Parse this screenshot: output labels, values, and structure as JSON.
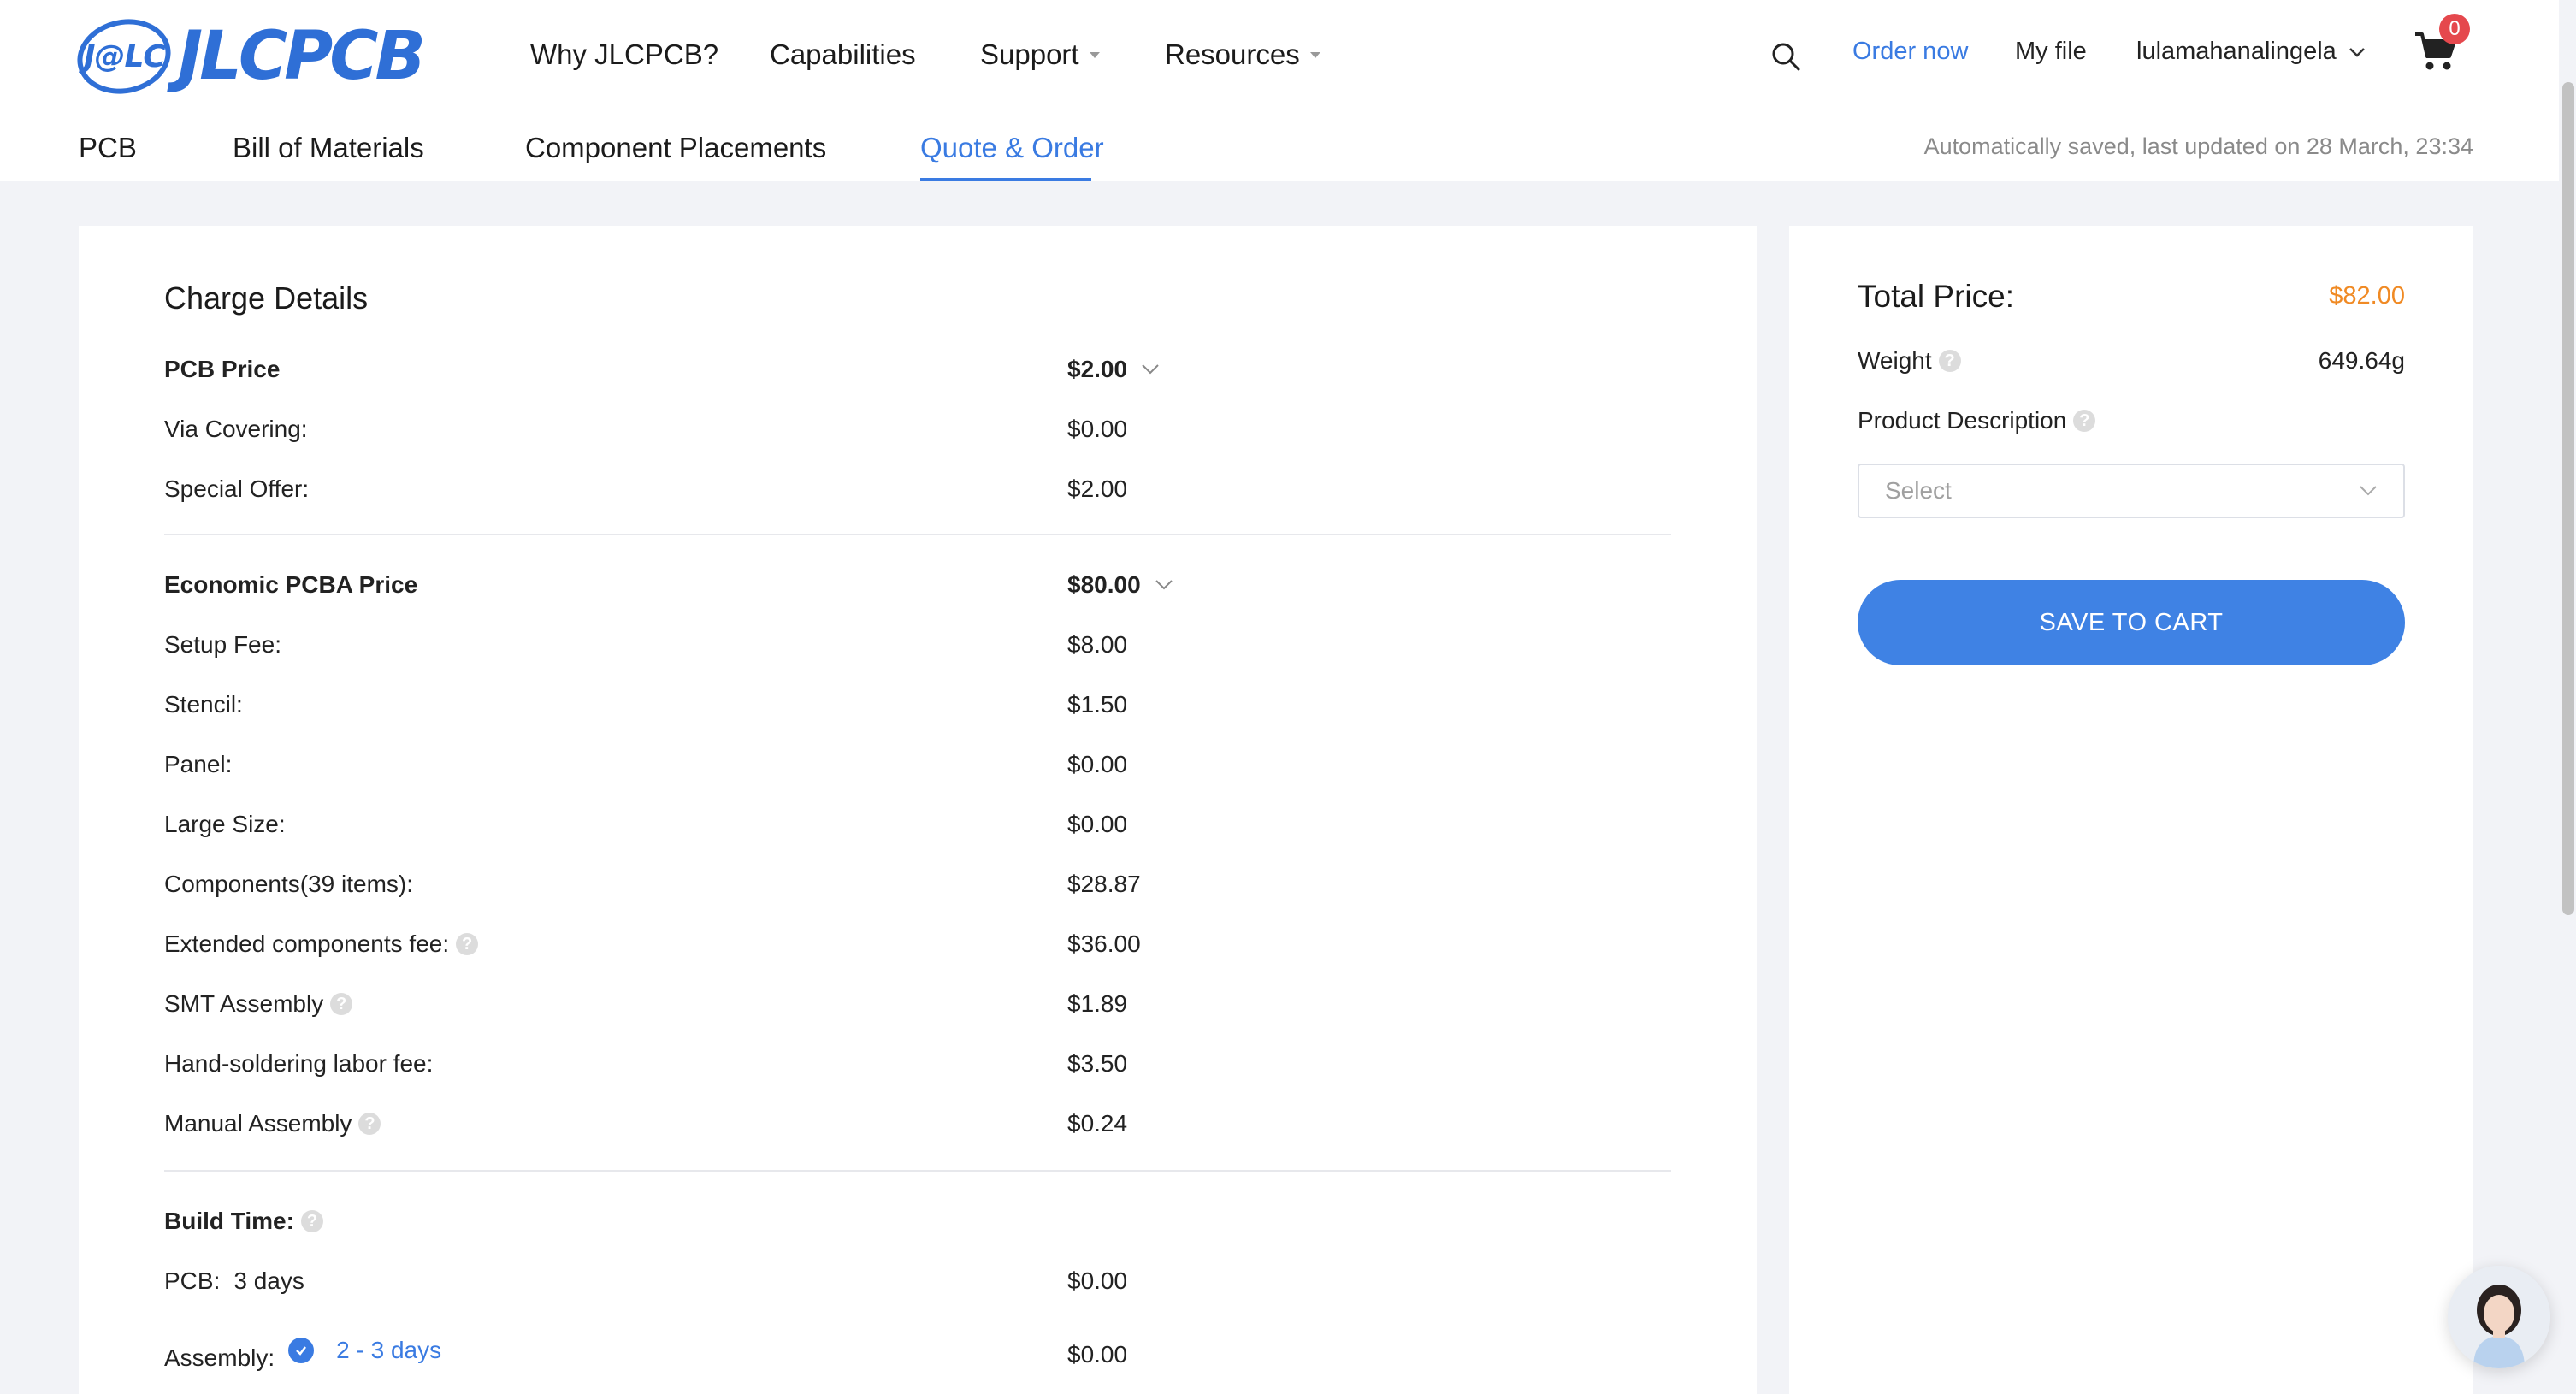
{
  "brand": {
    "logo_badge": "J@LC",
    "logo_text": "JLCPCB",
    "color": "#2f6fd6"
  },
  "header": {
    "nav": [
      {
        "label": "Why JLCPCB?"
      },
      {
        "label": "Capabilities"
      },
      {
        "label": "Support"
      },
      {
        "label": "Resources"
      }
    ],
    "order_now": "Order now",
    "my_file": "My file",
    "username": "lulamahanalingela",
    "cart_count": "0"
  },
  "subnav": {
    "tabs": [
      {
        "label": "PCB"
      },
      {
        "label": "Bill of Materials"
      },
      {
        "label": "Component Placements"
      },
      {
        "label": "Quote & Order",
        "active": true
      }
    ],
    "autosave": "Automatically saved, last updated on 28 March, 23:34"
  },
  "charge_details": {
    "title": "Charge Details",
    "pcb": {
      "label": "PCB Price",
      "value": "$2.00",
      "rows": [
        {
          "label": "Via Covering:",
          "value": "$0.00"
        },
        {
          "label": "Special Offer:",
          "value": "$2.00"
        }
      ]
    },
    "pcba": {
      "label": "Economic PCBA Price",
      "value": "$80.00",
      "rows": [
        {
          "label": "Setup Fee:",
          "value": "$8.00"
        },
        {
          "label": "Stencil:",
          "value": "$1.50"
        },
        {
          "label": "Panel:",
          "value": "$0.00"
        },
        {
          "label": "Large Size:",
          "value": "$0.00"
        },
        {
          "label": "Components(39 items):",
          "value": "$28.87"
        },
        {
          "label": "Extended components fee:",
          "value": "$36.00"
        },
        {
          "label": "SMT Assembly",
          "value": "$1.89"
        },
        {
          "label": "Hand-soldering labor fee:",
          "value": "$3.50"
        },
        {
          "label": "Manual Assembly",
          "value": "$0.24"
        }
      ]
    },
    "build_time": {
      "label": "Build Time:",
      "pcb_label": "PCB:",
      "pcb_days": "3 days",
      "pcb_value": "$0.00",
      "assembly_label": "Assembly:",
      "assembly_days": "2 - 3 days",
      "assembly_value": "$0.00"
    }
  },
  "summary": {
    "total_label": "Total Price:",
    "total_value": "$82.00",
    "weight_label": "Weight",
    "weight_value": "649.64g",
    "product_desc_label": "Product Description",
    "select_placeholder": "Select",
    "save_button": "SAVE TO CART"
  },
  "colors": {
    "accent": "#3a7be2",
    "price_orange": "#f08a24",
    "badge_red": "#e5484d"
  }
}
